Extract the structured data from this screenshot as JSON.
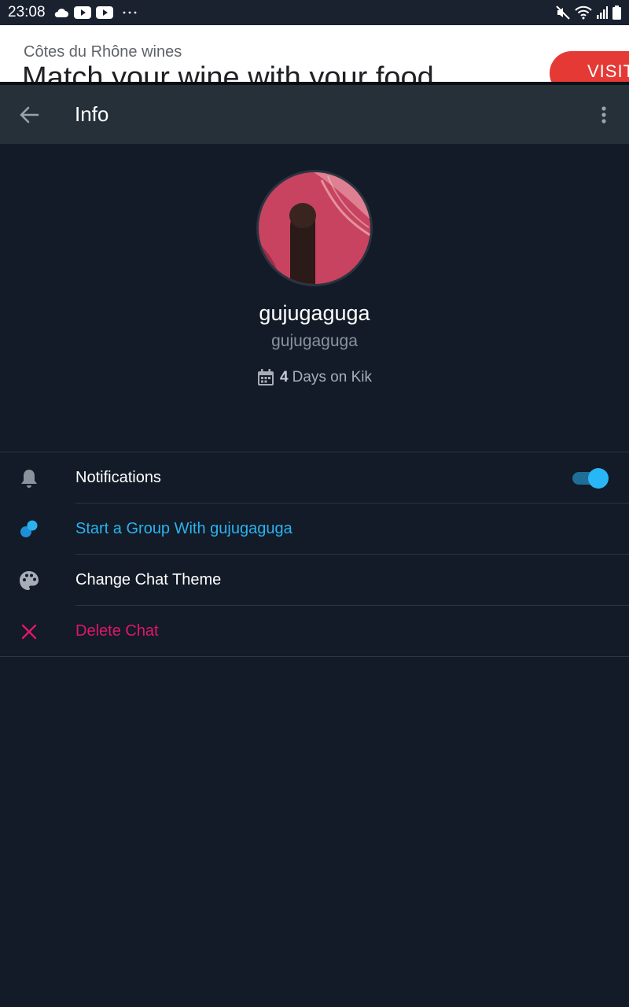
{
  "status_bar": {
    "time": "23:08",
    "left_icons": [
      "cloud-icon",
      "youtube-icon",
      "youtube-icon",
      "more-notifications-icon"
    ],
    "right_icons": [
      "mute-icon",
      "wifi-icon",
      "signal-icon",
      "battery-icon"
    ]
  },
  "ad": {
    "sponsor": "Côtes du Rhône wines",
    "headline": "Match your wine with your food",
    "cta": "VISIT",
    "accent": "#e53935"
  },
  "app_bar": {
    "title": "Info",
    "back_icon": "arrow-left-icon",
    "menu_icon": "more-vert-icon"
  },
  "profile": {
    "display_name": "gujugaguga",
    "username": "gujugaguga",
    "days_count": "4",
    "days_text": "Days on Kik"
  },
  "settings": {
    "notifications": {
      "label": "Notifications",
      "enabled": true,
      "icon": "bell-icon"
    },
    "start_group": {
      "label": "Start a Group With gujugaguga",
      "icon": "group-icon"
    },
    "chat_theme": {
      "label": "Change Chat Theme",
      "icon": "palette-icon"
    },
    "delete_chat": {
      "label": "Delete Chat",
      "icon": "close-icon"
    }
  },
  "colors": {
    "background": "#121b27",
    "app_bar": "#263039",
    "accent_blue": "#2bb2ee",
    "delete_pink": "#e0166e"
  }
}
